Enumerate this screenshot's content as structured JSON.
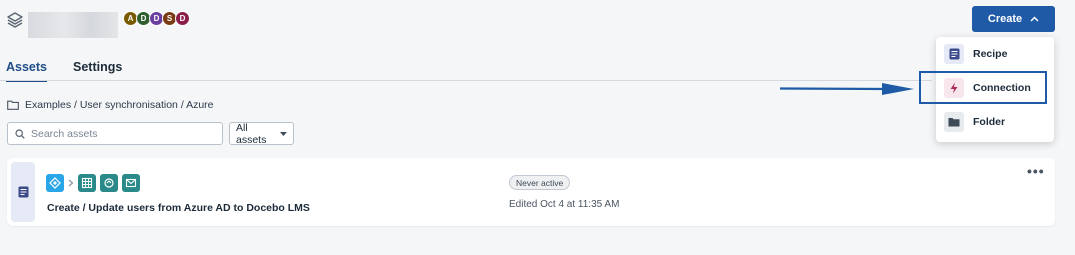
{
  "header": {
    "avatars": [
      {
        "initial": "A",
        "color": "#7a5a00"
      },
      {
        "initial": "D",
        "color": "#2e5e2e"
      },
      {
        "initial": "D",
        "color": "#6b3fa0"
      },
      {
        "initial": "S",
        "color": "#7a3b12"
      },
      {
        "initial": "D",
        "color": "#8a1f4a"
      }
    ],
    "create_label": "Create"
  },
  "tabs": [
    {
      "label": "Assets"
    },
    {
      "label": "Settings"
    }
  ],
  "breadcrumb": {
    "path": "Examples / User synchronisation / Azure"
  },
  "search": {
    "placeholder": "Search assets"
  },
  "filter": {
    "label": "All assets"
  },
  "recipe": {
    "name": "Create / Update users from Azure AD to Docebo LMS",
    "status": "Never active",
    "edited": "Edited Oct 4 at 11:35 AM"
  },
  "create_menu": {
    "items": [
      {
        "label": "Recipe",
        "icon": "recipe-icon"
      },
      {
        "label": "Connection",
        "icon": "lightning-icon"
      },
      {
        "label": "Folder",
        "icon": "folder-icon"
      }
    ]
  },
  "colors": {
    "accent": "#1f5aa6",
    "highlight": "#1f5aa6"
  }
}
